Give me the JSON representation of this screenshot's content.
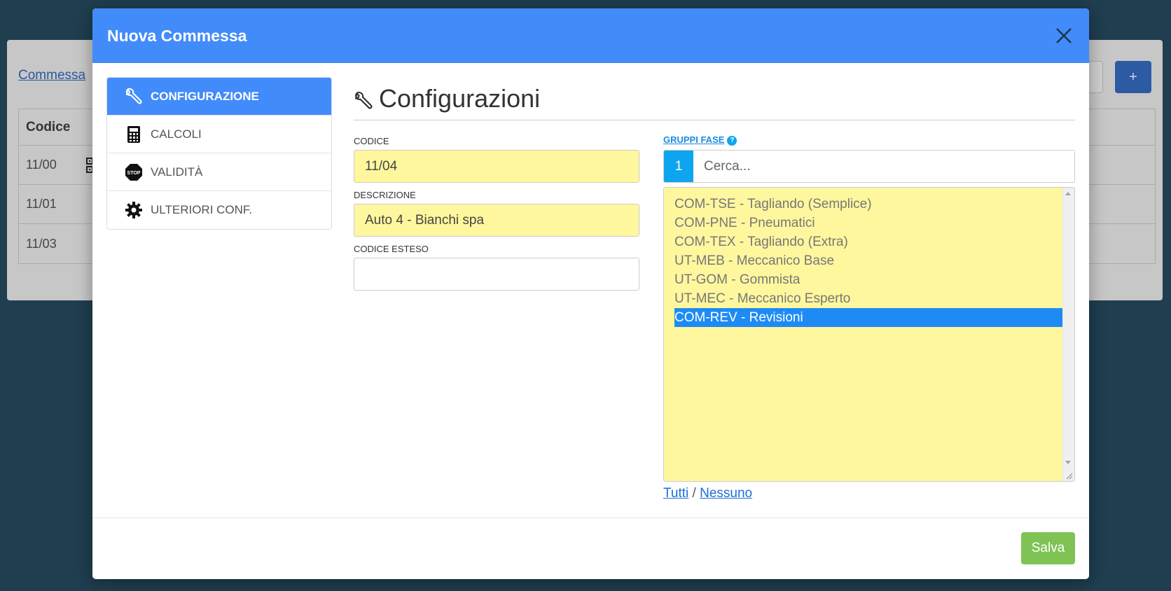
{
  "background": {
    "link": "Commessa",
    "plus_label": "+",
    "table": {
      "header": "Codice",
      "rows": [
        "11/00",
        "11/01",
        "11/03"
      ]
    }
  },
  "modal": {
    "title": "Nuova Commessa",
    "nav": [
      {
        "label": "CONFIGURAZIONE",
        "icon": "wrench-icon",
        "active": true
      },
      {
        "label": "CALCOLI",
        "icon": "calculator-icon",
        "active": false
      },
      {
        "label": "VALIDITÀ",
        "icon": "stop-sign-icon",
        "active": false
      },
      {
        "label": "ULTERIORI CONF.",
        "icon": "gear-icon",
        "active": false
      }
    ],
    "section_title": "Configurazioni",
    "fields": {
      "codice": {
        "label": "CODICE",
        "value": "11/04"
      },
      "descrizione": {
        "label": "DESCRIZIONE",
        "value": "Auto 4 - Bianchi spa"
      },
      "codice_esteso": {
        "label": "CODICE ESTESO",
        "value": ""
      }
    },
    "gruppi_fase": {
      "label": "GRUPPI FASE",
      "help": "?",
      "count": "1",
      "search_placeholder": "Cerca...",
      "items": [
        "COM-TSE - Tagliando (Semplice)",
        "COM-PNE - Pneumatici",
        "COM-TEX - Tagliando (Extra)",
        "UT-MEB - Meccanico Base",
        "UT-GOM - Gommista",
        "UT-MEC - Meccanico Esperto",
        "COM-REV - Revisioni"
      ],
      "selected": "COM-REV - Revisioni",
      "all_label": "Tutti",
      "separator": "/",
      "none_label": "Nessuno"
    },
    "save_label": "Salva"
  },
  "colors": {
    "header": "#428bfa",
    "yellow_field": "#fff79e",
    "selected_item": "#1e8bf5",
    "save_button": "#7ec353",
    "badge": "#0ea5f0"
  }
}
